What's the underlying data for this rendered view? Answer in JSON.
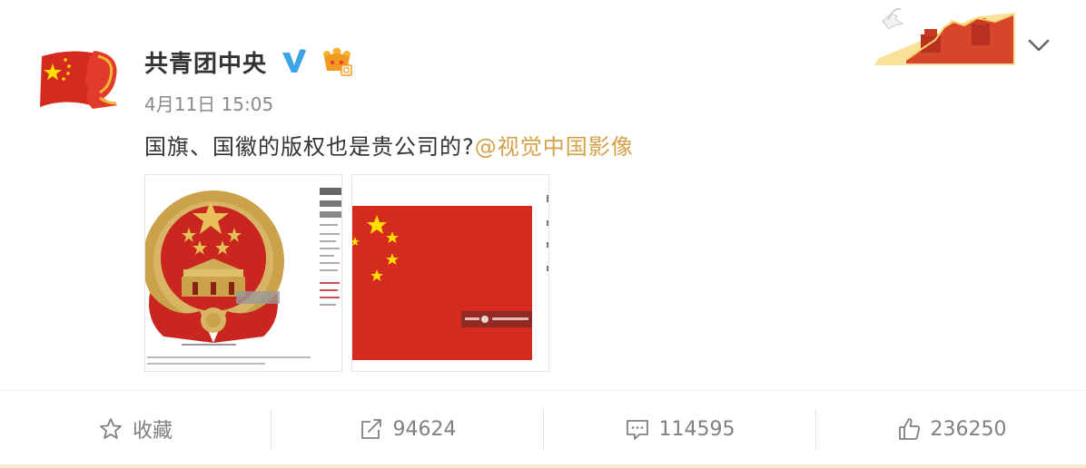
{
  "user": {
    "name": "共青团中央",
    "verified_icon": "verified-v-icon",
    "member_icon": "crown-member-icon"
  },
  "post": {
    "time": "4月11日 15:05",
    "text": "国旗、国徽的版权也是贵公司的?",
    "mention": "@视觉中国影像",
    "images": [
      "national-emblem-image",
      "national-flag-image"
    ]
  },
  "actions": {
    "favorite_label": "收藏",
    "repost_count": "94624",
    "comment_count": "114595",
    "like_count": "236250"
  },
  "colors": {
    "mention": "#d4a04a",
    "flag_red": "#d52b1e",
    "star_yellow": "#ffde00",
    "meta_gray": "#8a8a8a"
  }
}
